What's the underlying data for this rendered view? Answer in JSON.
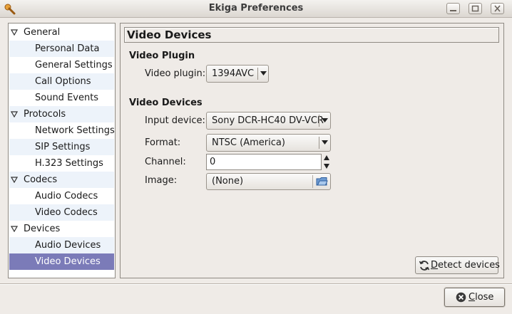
{
  "window": {
    "title": "Ekiga Preferences",
    "controls": [
      "minimize",
      "maximize",
      "close"
    ]
  },
  "sidebar": {
    "items": [
      {
        "label": "General",
        "level": 0,
        "expanded": true
      },
      {
        "label": "Personal Data",
        "level": 1
      },
      {
        "label": "General Settings",
        "level": 1
      },
      {
        "label": "Call Options",
        "level": 1
      },
      {
        "label": "Sound Events",
        "level": 1
      },
      {
        "label": "Protocols",
        "level": 0,
        "expanded": true
      },
      {
        "label": "Network Settings",
        "level": 1
      },
      {
        "label": "SIP Settings",
        "level": 1
      },
      {
        "label": "H.323 Settings",
        "level": 1
      },
      {
        "label": "Codecs",
        "level": 0,
        "expanded": true
      },
      {
        "label": "Audio Codecs",
        "level": 1
      },
      {
        "label": "Video Codecs",
        "level": 1
      },
      {
        "label": "Devices",
        "level": 0,
        "expanded": true
      },
      {
        "label": "Audio Devices",
        "level": 1
      },
      {
        "label": "Video Devices",
        "level": 1,
        "selected": true
      }
    ]
  },
  "main": {
    "page_title": "Video Devices",
    "plugin_section": {
      "heading": "Video Plugin",
      "plugin_label": "Video plugin:",
      "plugin_value": "1394AVC"
    },
    "devices_section": {
      "heading": "Video Devices",
      "input_label": "Input device:",
      "input_value": "Sony DCR-HC40 DV-VCR",
      "format_label": "Format:",
      "format_value": "NTSC (America)",
      "channel_label": "Channel:",
      "channel_value": "0",
      "image_label": "Image:",
      "image_value": "(None)"
    },
    "detect_button": {
      "mnemonic": "D",
      "rest": "etect devices",
      "icon": "refresh-icon"
    }
  },
  "footer": {
    "close_button": {
      "mnemonic": "C",
      "rest": "lose",
      "icon": "close-icon"
    }
  },
  "colors": {
    "window_bg": "#efebe7",
    "selection": "#7b7bb8",
    "row_alt": "#edf3fa"
  }
}
